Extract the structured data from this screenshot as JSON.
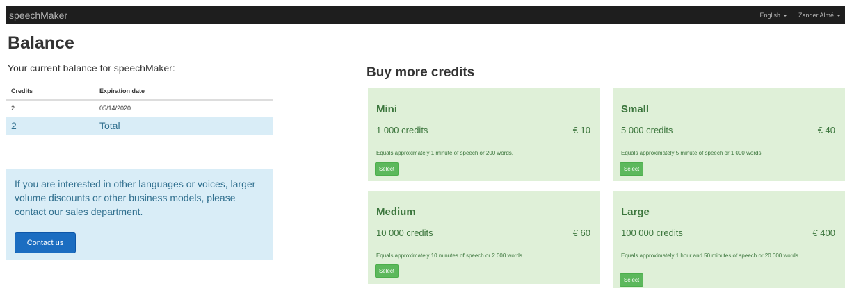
{
  "nav": {
    "brand": "speechMaker",
    "language": "English",
    "user": "Zander Almé"
  },
  "balance": {
    "title": "Balance",
    "subtitle": "Your current balance for speechMaker:",
    "columns": [
      "Credits",
      "Expiration date"
    ],
    "rows": [
      {
        "credits": "2",
        "expiration": "05/14/2020"
      }
    ],
    "total": {
      "credits": "2",
      "label": "Total"
    }
  },
  "info": {
    "text": "If you are interested in other languages or voices, larger volume discounts or other business models, please contact our sales department.",
    "button": "Contact us"
  },
  "buy": {
    "title": "Buy more credits",
    "packages": [
      {
        "name": "Mini",
        "credits": "1 000 credits",
        "price": "€ 10",
        "description": "Equals approximately 1 minute of speech or 200 words.",
        "button": "Select"
      },
      {
        "name": "Small",
        "credits": "5 000 credits",
        "price": "€ 40",
        "description": "Equals approximately 5 minute of speech or 1 000 words.",
        "button": "Select"
      },
      {
        "name": "Medium",
        "credits": "10 000 credits",
        "price": "€ 60",
        "description": "Equals approximately 10 minutes of speech or 2 000 words.",
        "button": "Select"
      },
      {
        "name": "Large",
        "credits": "100 000 credits",
        "price": "€ 400",
        "description": "Equals approximately 1 hour and 50 minutes of speech or 20 000 words.",
        "button": "Select"
      }
    ]
  },
  "colors": {
    "navbar": "#1e1e1e",
    "info_bg": "#d9edf7",
    "info_text": "#31708f",
    "card_bg": "#dff0d8",
    "card_text": "#3c763d",
    "select_button": "#5cb85c",
    "contact_button": "#1b6dc1"
  }
}
